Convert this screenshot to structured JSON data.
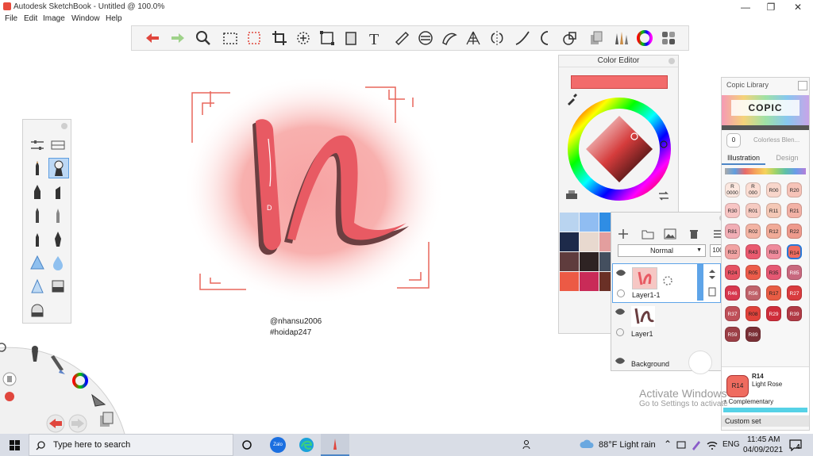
{
  "window": {
    "title": "Autodesk SketchBook - Untitled @ 100.0%"
  },
  "menu": [
    "File",
    "Edit",
    "Image",
    "Window",
    "Help"
  ],
  "toolbar": {
    "icons": [
      "undo-icon",
      "redo-icon",
      "zoom-icon",
      "select-rect-icon",
      "lasso-select-icon",
      "crop-icon",
      "transform-icon",
      "distort-icon",
      "perspective-icon",
      "text-icon",
      "ruler-icon",
      "ellipse-guide-icon",
      "french-curve-icon",
      "perspective-grid-icon",
      "symmetry-icon",
      "stroke-icon",
      "shape-icon",
      "fill-icon",
      "layer-editor-icon",
      "brush-library-icon",
      "color-wheel-icon",
      "copic-library-icon"
    ]
  },
  "canvas": {
    "signature_line1": "@nhansu2006",
    "signature_line2": "#hoidap247"
  },
  "color_editor": {
    "title": "Color Editor",
    "current_color": "#f26b6b",
    "swatches": [
      "#b9d4f0",
      "#90bdf2",
      "#2f8de4",
      "#1d2a4a",
      "#e8d9cf",
      "#e39e9e",
      "#5f3c3d",
      "#2e2323",
      "#444f5f",
      "#ec5a45",
      "#c92b58",
      "#6a3026"
    ]
  },
  "layers": {
    "blend_mode": "Normal",
    "opacity": "100",
    "items": [
      {
        "name": "Layer1-1"
      },
      {
        "name": "Layer1"
      },
      {
        "name": "Background"
      }
    ]
  },
  "copic": {
    "title": "Copic Library",
    "logo": "COPIC",
    "colorless": "Colorless Blen...",
    "colorless_code": "0",
    "tab_illustration": "Illustration",
    "tab_design": "Design",
    "chips": [
      {
        "code": "R\n0000",
        "color": "#fbe7df"
      },
      {
        "code": "R\n000",
        "color": "#fbddd3"
      },
      {
        "code": "R00",
        "color": "#f8d6cb"
      },
      {
        "code": "R20",
        "color": "#f6c3b8"
      },
      {
        "code": "R30",
        "color": "#f7c5c4"
      },
      {
        "code": "R01",
        "color": "#f6cbc2"
      },
      {
        "code": "R11",
        "color": "#f4c8b6"
      },
      {
        "code": "R21",
        "color": "#f2b1a5"
      },
      {
        "code": "R81",
        "color": "#f1aeb5"
      },
      {
        "code": "R02",
        "color": "#f3b4a4"
      },
      {
        "code": "R12",
        "color": "#f1ab98"
      },
      {
        "code": "R22",
        "color": "#ee9a8c"
      },
      {
        "code": "R32",
        "color": "#f1a3a3"
      },
      {
        "code": "R43",
        "color": "#ea5a6f"
      },
      {
        "code": "R83",
        "color": "#ef8b9c"
      },
      {
        "code": "R14",
        "color": "#ef6b5f"
      },
      {
        "code": "R24",
        "color": "#e65363"
      },
      {
        "code": "R05",
        "color": "#ec5c4a"
      },
      {
        "code": "R35",
        "color": "#e55873"
      },
      {
        "code": "R85",
        "color": "#c8687e"
      },
      {
        "code": "R46",
        "color": "#d7374e"
      },
      {
        "code": "R56",
        "color": "#c0626a"
      },
      {
        "code": "R17",
        "color": "#e85c44"
      },
      {
        "code": "R27",
        "color": "#d93b3e"
      },
      {
        "code": "R37",
        "color": "#bf4f58"
      },
      {
        "code": "R08",
        "color": "#e0423a"
      },
      {
        "code": "R29",
        "color": "#cf2d3a"
      },
      {
        "code": "R39",
        "color": "#b13a45"
      },
      {
        "code": "R59",
        "color": "#9c3f46"
      },
      {
        "code": "R89",
        "color": "#7a3036"
      }
    ],
    "selected_code": "R14",
    "selected_name": "Light Rose",
    "selected_color": "#ef6b5f",
    "complementary": "Complementary",
    "custom_set": "Custom set"
  },
  "watermark": {
    "line1": "Activate Windows",
    "line2": "Go to Settings to activate"
  },
  "taskbar": {
    "search": "Type here to search",
    "weather": "88°F  Light rain",
    "lang": "ENG",
    "time": "11:45 AM",
    "date": "04/09/2021",
    "notifications": "4"
  }
}
